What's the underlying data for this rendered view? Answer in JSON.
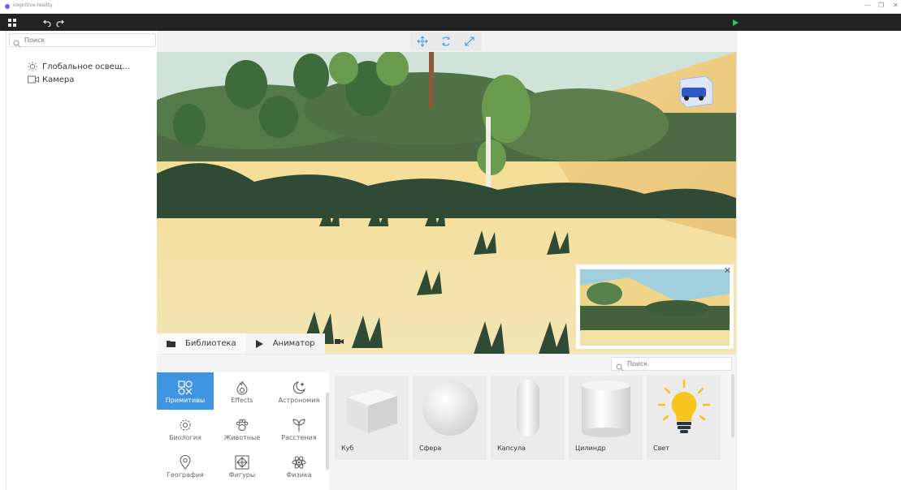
{
  "window": {
    "title": "cognitive-reality"
  },
  "sidebar": {
    "search_placeholder": "Поиск",
    "items": [
      {
        "label": "Глобальное освещ...",
        "icon": "sun-icon"
      },
      {
        "label": "Камера",
        "icon": "camera-icon"
      }
    ]
  },
  "tabs": [
    {
      "label": "Библиотека",
      "icon": "folder-icon"
    },
    {
      "label": "Аниматор",
      "icon": "play-icon"
    }
  ],
  "library": {
    "search_placeholder": "Поиск",
    "categories": [
      {
        "label": "Примитивы",
        "icon": "primitives-icon",
        "active": true
      },
      {
        "label": "Effects",
        "icon": "flame-icon"
      },
      {
        "label": "Астрономия",
        "icon": "moon-star-icon"
      },
      {
        "label": "Биология",
        "icon": "cell-icon"
      },
      {
        "label": "Животные",
        "icon": "paw-icon"
      },
      {
        "label": "Расстения",
        "icon": "sprout-icon"
      },
      {
        "label": "География",
        "icon": "location-pin-icon"
      },
      {
        "label": "Фигуры",
        "icon": "polyhedron-icon"
      },
      {
        "label": "Физика",
        "icon": "atom-icon"
      }
    ],
    "assets": [
      {
        "label": "Куб",
        "icon": "cube-icon"
      },
      {
        "label": "Сфера",
        "icon": "sphere-icon"
      },
      {
        "label": "Капсула",
        "icon": "capsule-icon"
      },
      {
        "label": "Цилиндр",
        "icon": "cylinder-icon"
      },
      {
        "label": "Свет",
        "icon": "light-bulb-icon"
      }
    ]
  },
  "colors": {
    "toolbar_bg": "#232323",
    "accent": "#3f95e2",
    "play": "#1fcf4a",
    "sky": "#c7e4ef",
    "sand": "#f0d48a",
    "foliage": "#3e5d3a"
  }
}
